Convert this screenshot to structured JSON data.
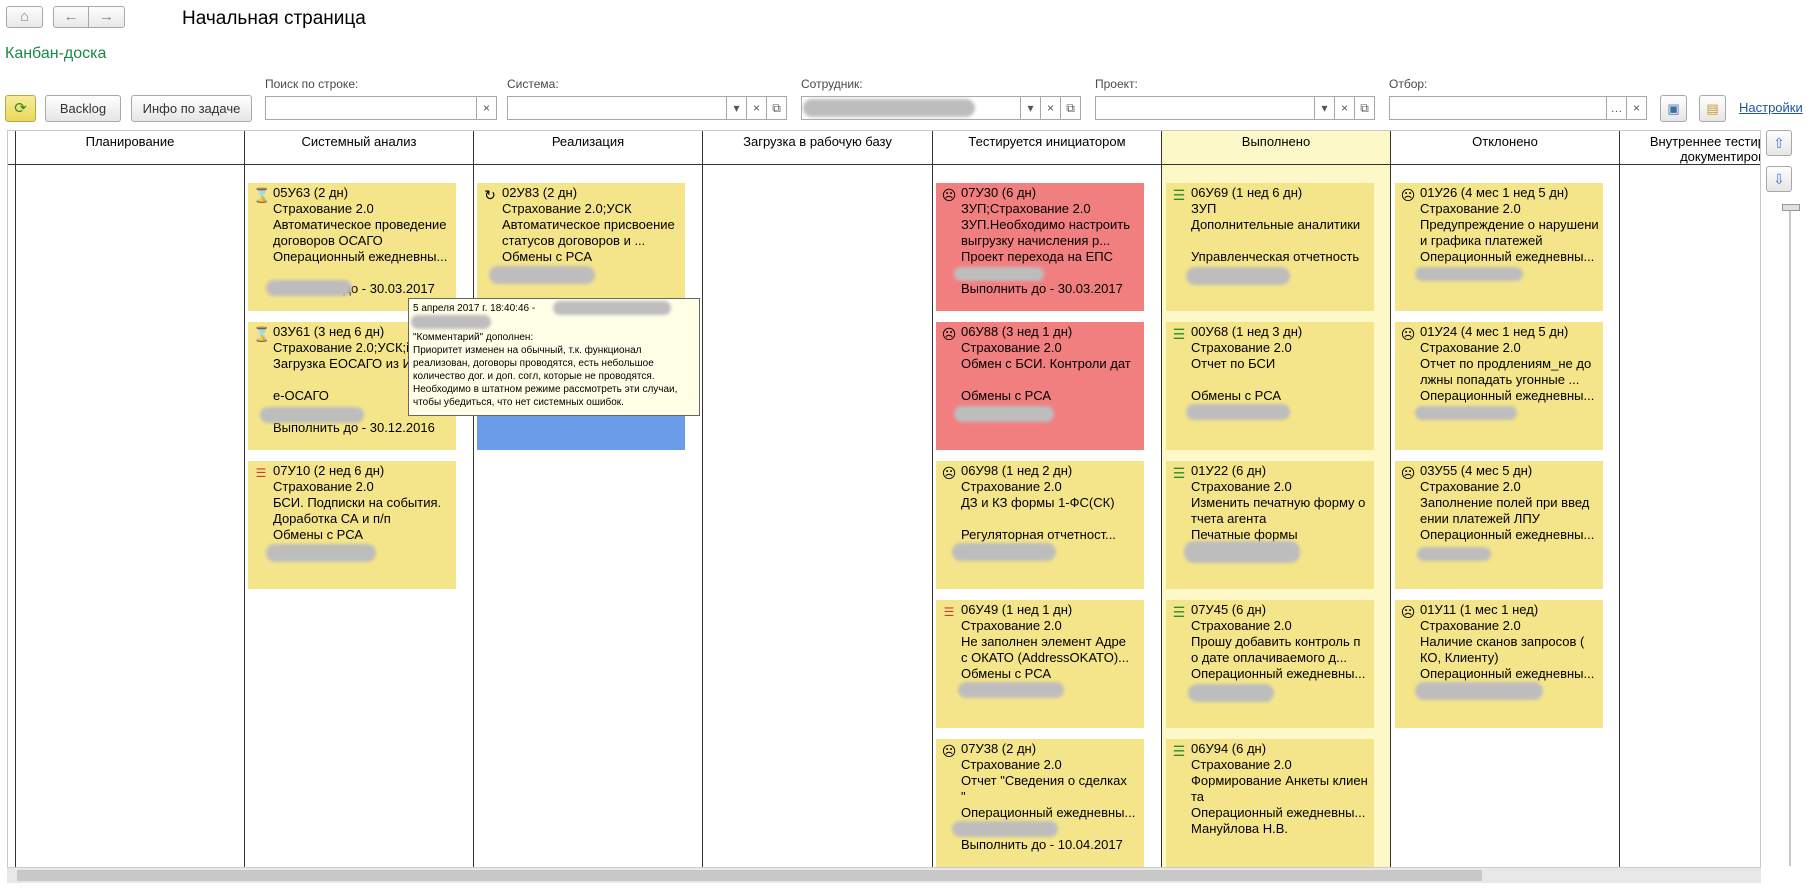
{
  "nav": {
    "home_icon": "home-icon",
    "back_icon": "arrow-left-icon",
    "forward_icon": "arrow-right-icon"
  },
  "window_title": "Начальная страница",
  "subtitle": "Канбан-доска",
  "toolbar": {
    "backlog_label": "Backlog",
    "info_label": "Инфо по задаче",
    "settings_link": "Настройки"
  },
  "filters": {
    "search_label": "Поиск по строке:",
    "system_label": "Система:",
    "employee_label": "Сотрудник:",
    "project_label": "Проект:",
    "selection_label": "Отбор:"
  },
  "columns": [
    "Планирование",
    "Системный анализ",
    "Реализация",
    "Загрузка в рабочую базу",
    "Тестируется инициатором",
    "Выполнено",
    "Отклонено",
    "Внутреннее тестир документиров"
  ],
  "cards": [
    {
      "icon": "hourglass-icon",
      "lines": [
        "05У63 (2 дн)",
        "Страхование 2.0",
        "Автоматическое проведение",
        "договоров ОСАГО",
        "Операционный ежедневны...",
        "",
        "Выполнить до - 30.03.2017"
      ]
    },
    {
      "icon": "hourglass-icon",
      "lines": [
        "03У61 (3 нед 6 дн)",
        "Страхование 2.0;УСК;iC",
        "Загрузка ЕОСАГО из И",
        "",
        "е-ОСАГО",
        "",
        "Выполнить до - 30.12.2016"
      ]
    },
    {
      "icon": "priority-low-icon",
      "lines": [
        "07У10 (2 нед 6 дн)",
        "Страхование 2.0",
        "БСИ. Подписки на события.",
        "Доработка СА и п/п",
        "Обмены с РСА"
      ]
    },
    {
      "icon": "refresh-icon",
      "lines": [
        "02У83 (2 дн)",
        "Страхование 2.0;УСК",
        "Автоматическое присвоение",
        "статусов договоров и ...",
        "Обмены с РСА"
      ]
    },
    {
      "icon": "face-icon",
      "lines": [
        "07У30 (6 дн)",
        "ЗУП;Страхование 2.0",
        "ЗУП.Необходимо настроить",
        "выгрузку начисления р...",
        "Проект перехода на ЕПС",
        "",
        "Выполнить до - 30.03.2017"
      ]
    },
    {
      "icon": "face-icon",
      "lines": [
        "06У88 (3 нед 1 дн)",
        "Страхование 2.0",
        "Обмен с БСИ. Контроли дат",
        "",
        "Обмены с РСА"
      ]
    },
    {
      "icon": "face-icon",
      "lines": [
        "06У98 (1 нед 2 дн)",
        "Страхование 2.0",
        "ДЗ и КЗ формы 1-ФС(СК)",
        "",
        "Регуляторная отчетност..."
      ]
    },
    {
      "icon": "priority-low-icon",
      "lines": [
        "06У49 (1 нед 1 дн)",
        "Страхование 2.0",
        "Не заполнен элемент Адре",
        "с ОКАТО (AddressOKATO)...",
        "Обмены с РСА"
      ]
    },
    {
      "icon": "face-icon",
      "lines": [
        "07У38 (2 дн)",
        "Страхование 2.0",
        "Отчет \"Сведения о сделках",
        "\"",
        "Операционный ежедневны...",
        "",
        "Выполнить до - 10.04.2017"
      ]
    },
    {
      "icon": "priority-normal-icon",
      "lines": [
        "06У69 (1 нед 6 дн)",
        "ЗУП",
        "Дополнительные аналитики",
        "",
        "Управленческая отчетность"
      ]
    },
    {
      "icon": "priority-normal-icon",
      "lines": [
        "00У68 (1 нед 3 дн)",
        "Страхование 2.0",
        "Отчет по БСИ",
        "",
        "Обмены с РСА"
      ]
    },
    {
      "icon": "priority-normal-icon",
      "lines": [
        "01У22 (6 дн)",
        "Страхование 2.0",
        "Изменить печатную форму о",
        "тчета агента",
        "Печатные формы"
      ]
    },
    {
      "icon": "priority-normal-icon",
      "lines": [
        "07У45 (6 дн)",
        "Страхование 2.0",
        "Прошу добавить контроль п",
        "о дате оплачиваемого д...",
        "Операционный ежедневны..."
      ]
    },
    {
      "icon": "priority-normal-icon",
      "lines": [
        "06У94 (6 дн)",
        "Страхование 2.0",
        "Формирование Анкеты клиен",
        "та",
        "Операционный ежедневны...",
        "Мануйлова Н.В."
      ]
    },
    {
      "icon": "face-icon",
      "lines": [
        "01У26 (4 мес 1 нед 5 дн)",
        "Страхование 2.0",
        "Предупреждение о нарушени",
        "и графика платежей",
        "Операционный ежедневны..."
      ]
    },
    {
      "icon": "face-icon",
      "lines": [
        "01У24 (4 мес 1 нед 5 дн)",
        "Страхование 2.0",
        "Отчет по продлениям_не до",
        "лжны попадать угонные ...",
        "Операционный ежедневны..."
      ]
    },
    {
      "icon": "face-icon",
      "lines": [
        "03У55 (4 мес 5 дн)",
        "Страхование 2.0",
        "Заполнение полей при введ",
        "ении платежей ЛПУ",
        "Операционный ежедневны..."
      ]
    },
    {
      "icon": "face-icon",
      "lines": [
        "01У11 (1 мес 1 нед)",
        "Страхование 2.0",
        "Наличие сканов запросов (",
        "КО, Клиенту)",
        "Операционный ежедневны..."
      ]
    }
  ],
  "tooltip": {
    "header": "5 апреля 2017 г. 18:40:46 -",
    "lines": [
      "\"Комментарий\" дополнен:",
      "Приоритет изменен на обычный, т.к. функционал",
      "реализован, договоры проводятся, есть небольшое",
      "количество дог. и доп. согл, которые не проводятся.",
      "Необходимо в штатном режиме рассмотреть эти случаи,",
      "чтобы убедиться, что нет системных ошибок."
    ]
  }
}
